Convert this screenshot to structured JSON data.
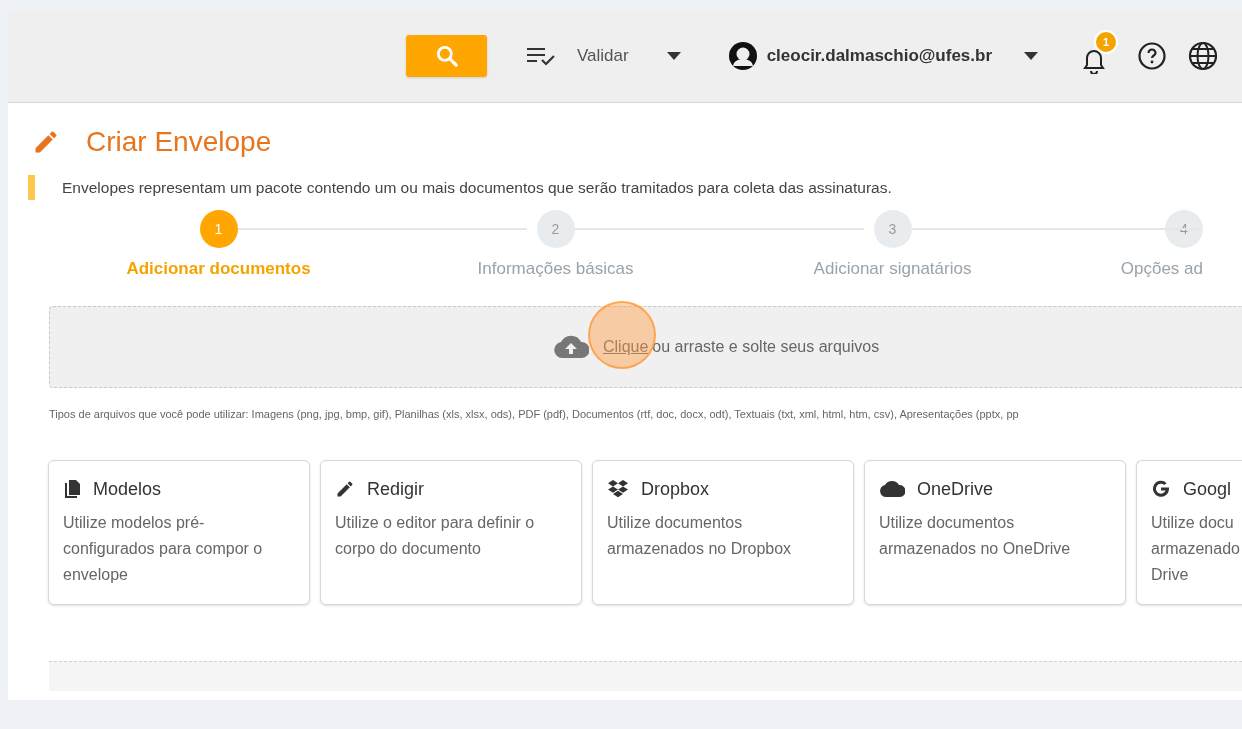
{
  "header": {
    "validate_label": "Validar",
    "user_email": "cleocir.dalmaschio@ufes.br",
    "notification_count": "1"
  },
  "page": {
    "title": "Criar Envelope",
    "description": "Envelopes representam um pacote contendo um ou mais documentos que serão tramitados para coleta das assinaturas."
  },
  "steps": [
    {
      "number": "1",
      "label": "Adicionar documentos",
      "selected": true
    },
    {
      "number": "2",
      "label": "Informações básicas",
      "selected": false
    },
    {
      "number": "3",
      "label": "Adicionar signatários",
      "selected": false
    },
    {
      "number": "4",
      "label": "Opções ad",
      "selected": false
    }
  ],
  "upload": {
    "link": "Clique",
    "text": "ou arraste e solte seus arquivos",
    "file_types": "Tipos de arquivos que você pode utilizar: Imagens (png, jpg, bmp, gif), Planilhas (xls, xlsx, ods), PDF (pdf), Documentos (rtf, doc, docx, odt), Textuais (txt, xml, html, htm, csv), Apresentações (pptx, pp"
  },
  "sources": [
    {
      "kind": "templates",
      "title": "Modelos",
      "description": "Utilize modelos pré-configurados para compor o envelope"
    },
    {
      "kind": "compose",
      "title": "Redigir",
      "description": "Utilize o editor para definir o corpo do documento"
    },
    {
      "kind": "dropbox",
      "title": "Dropbox",
      "description": "Utilize documentos armazenados no Dropbox"
    },
    {
      "kind": "onedrive",
      "title": "OneDrive",
      "description": "Utilize documentos armazenados no OneDrive"
    },
    {
      "kind": "google",
      "title": "Googl",
      "description": "Utilize docu armazenado Drive"
    }
  ]
}
